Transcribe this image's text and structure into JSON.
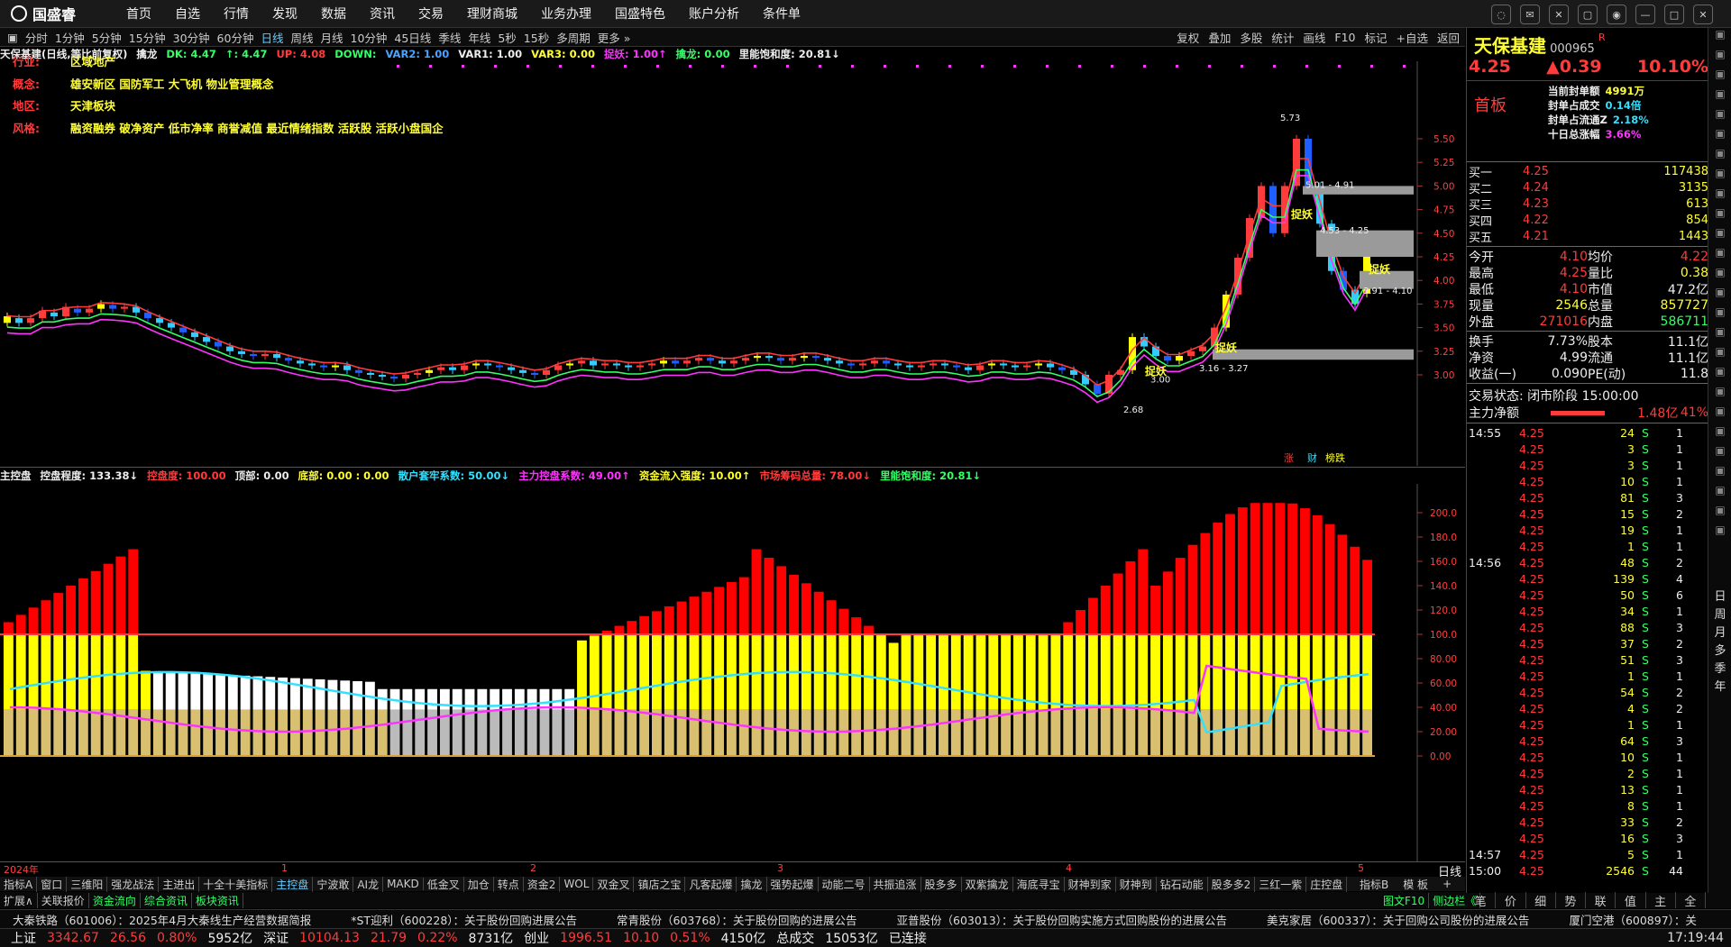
{
  "app": {
    "brand": "国盛睿"
  },
  "menu": [
    "首页",
    "自选",
    "行情",
    "发现",
    "数据",
    "资讯",
    "交易",
    "理财商城",
    "业务办理",
    "国盛特色",
    "账户分析",
    "条件单"
  ],
  "periods": [
    "分时",
    "1分钟",
    "5分钟",
    "15分钟",
    "30分钟",
    "60分钟",
    "日线",
    "周线",
    "月线",
    "10分钟",
    "45日线",
    "季线",
    "年线",
    "5秒",
    "15秒",
    "多周期",
    "更多"
  ],
  "period_active": "日线",
  "tools": [
    "复权",
    "叠加",
    "多股",
    "统计",
    "画线",
    "F10",
    "标记",
    "+自选",
    "返回"
  ],
  "main_title": "天保基建(日线,等比前复权)",
  "main_ind_name": "擒龙",
  "main_ind": [
    {
      "t": "DK: 4.47",
      "c": "#33ff66"
    },
    {
      "t": "↑: 4.47",
      "c": "#33ff66"
    },
    {
      "t": "UP: 4.08",
      "c": "#ff3b3b"
    },
    {
      "t": "DOWN: ",
      "c": "#33ff66"
    },
    {
      "t": "VAR2: 1.00",
      "c": "#4aa3ff"
    },
    {
      "t": "VAR1: 1.00",
      "c": "#eee"
    },
    {
      "t": "VAR3: 0.00",
      "c": "#ffff33"
    },
    {
      "t": "捉妖: 1.00↑",
      "c": "#ff33ff"
    },
    {
      "t": "擒龙: 0.00",
      "c": "#33ff66"
    },
    {
      "t": "里能饱和度: 20.81↓",
      "c": "#eee"
    }
  ],
  "info": [
    {
      "k": "行业:",
      "v": "区域地产"
    },
    {
      "k": "概念:",
      "v": "雄安新区 国防军工 大飞机 物业管理概念"
    },
    {
      "k": "地区:",
      "v": "天津板块"
    },
    {
      "k": "风格:",
      "v": "融资融券 破净资产 低市净率 商誉减值 最近情绪指数 活跃股 活跃小盘国企"
    }
  ],
  "price_axis": [
    "5.50",
    "5.25",
    "5.00",
    "4.75",
    "4.50",
    "4.25",
    "4.00",
    "3.75",
    "3.50",
    "3.25",
    "3.00"
  ],
  "annotations": {
    "high": "5.73",
    "low": "2.68",
    "r1": "5.01 - 4.91",
    "r2": "4.53 - 4.25",
    "r3": "3.91 - 4.10",
    "r4": "3.16 - 3.27",
    "r5": "3.00",
    "tag": "捉妖",
    "bottom_tags": [
      "涨",
      "财",
      "榜跌"
    ]
  },
  "sub_title": "主控盘",
  "sub_ind": [
    {
      "t": "控盘程度: 133.38↓",
      "c": "#eee"
    },
    {
      "t": "控盘度: 100.00",
      "c": "#ff3b3b"
    },
    {
      "t": "顶部: 0.00",
      "c": "#eee"
    },
    {
      "t": "底部: 0.00 : 0.00",
      "c": "#ffff33"
    },
    {
      "t": "散户套牢系数: 50.00↓",
      "c": "#33e0ff"
    },
    {
      "t": "主力控盘系数: 49.00↑",
      "c": "#ff33ff"
    },
    {
      "t": "资金流入强度: 10.00↑",
      "c": "#ffff33"
    },
    {
      "t": "市场筹码总量: 78.00↓",
      "c": "#ff3b3b"
    },
    {
      "t": "里能饱和度: 20.81↓",
      "c": "#33ff66"
    }
  ],
  "sub_axis": [
    "200.0",
    "180.0",
    "160.0",
    "140.0",
    "120.0",
    "100.0",
    "80.00",
    "60.00",
    "40.00",
    "20.00",
    "0.00"
  ],
  "date_axis": [
    "2024年",
    "1",
    "2",
    "3",
    "4",
    "5"
  ],
  "date_axis_right": "日线",
  "bottom_tabs": [
    "指标A",
    "窗口",
    "三维阳",
    "强龙战法",
    "主进出",
    "十全十美指标",
    "主控盘",
    "宁波敢",
    "AI龙",
    "MAKD",
    "低金叉",
    "加仓",
    "转点",
    "资金2",
    "WOL",
    "双金叉",
    "镇店之宝",
    "凡客起爆",
    "擒龙",
    "强势起爆",
    "动能二号",
    "共振追涨",
    "股多多",
    "双紫擒龙",
    "海底寻宝",
    "财神到家",
    "财神到",
    "钻石动能",
    "股多多2",
    "三红一紫",
    "庄控盘"
  ],
  "bottom_tab_active": "主控盘",
  "bottom_tabs_right": [
    "指标B",
    "模 板",
    "+",
    "-"
  ],
  "sub_tabs": [
    "扩展∧",
    "关联报价",
    "资金流向",
    "综合资讯",
    "板块资讯"
  ],
  "sub_tabs_right": [
    "图文F10",
    "侧边栏《"
  ],
  "news": [
    "大秦铁路（601006）：2025年4月大秦线生产经营数据简报",
    "*ST迎利（600228）：关于股份回购进展公告",
    "常青股份（603768）：关于股份回购的进展公告",
    "亚普股份（603013）：关于股份回购实施方式回购股份的进展公告",
    "美克家居（600337）：关于回购公司股份的进展公告",
    "厦门空港（600897）：关"
  ],
  "status": [
    {
      "t": "上证",
      "c": "#eee"
    },
    {
      "t": "3342.67",
      "c": "#ff3b3b"
    },
    {
      "t": "26.56",
      "c": "#ff3b3b"
    },
    {
      "t": "0.80%",
      "c": "#ff3b3b"
    },
    {
      "t": "5952亿",
      "c": "#eee"
    },
    {
      "t": "深证",
      "c": "#eee"
    },
    {
      "t": "10104.13",
      "c": "#ff3b3b"
    },
    {
      "t": "21.79",
      "c": "#ff3b3b"
    },
    {
      "t": "0.22%",
      "c": "#ff3b3b"
    },
    {
      "t": "8731亿",
      "c": "#eee"
    },
    {
      "t": "创业",
      "c": "#eee"
    },
    {
      "t": "1996.51",
      "c": "#ff3b3b"
    },
    {
      "t": "10.10",
      "c": "#ff3b3b"
    },
    {
      "t": "0.51%",
      "c": "#ff3b3b"
    },
    {
      "t": "4150亿",
      "c": "#eee"
    },
    {
      "t": "总成交",
      "c": "#eee"
    },
    {
      "t": "15053亿",
      "c": "#eee"
    },
    {
      "t": "已连接",
      "c": "#eee"
    }
  ],
  "clock": "17:19:44",
  "quote": {
    "name": "天保基建",
    "code": "000965",
    "mark": "R",
    "price": "4.25",
    "change": "▲0.39",
    "pct": "10.10%",
    "board": "首板",
    "stats": [
      {
        "k": "当前封单额",
        "v": "4991万"
      },
      {
        "k": "封单占成交",
        "v": "0.14倍"
      },
      {
        "k": "封单占流通Z",
        "v": "2.18%"
      },
      {
        "k": "十日总涨幅",
        "v": "3.66%"
      }
    ],
    "book": [
      {
        "k": "买一",
        "p": "4.25",
        "v": "117438"
      },
      {
        "k": "买二",
        "p": "4.24",
        "v": "3135"
      },
      {
        "k": "买三",
        "p": "4.23",
        "v": "613"
      },
      {
        "k": "买四",
        "p": "4.22",
        "v": "854"
      },
      {
        "k": "买五",
        "p": "4.21",
        "v": "1443"
      }
    ],
    "detail": [
      {
        "k1": "今开",
        "v1": "4.10",
        "k2": "均价",
        "v2": "4.22"
      },
      {
        "k1": "最高",
        "v1": "4.25",
        "k2": "量比",
        "v2": "0.38"
      },
      {
        "k1": "最低",
        "v1": "4.10",
        "k2": "市值",
        "v2": "47.2亿"
      },
      {
        "k1": "现量",
        "v1": "2546",
        "k2": "总量",
        "v2": "857727"
      },
      {
        "k1": "外盘",
        "v1": "271016",
        "k2": "内盘",
        "v2": "586711"
      }
    ],
    "detail2": [
      {
        "k1": "换手",
        "v1": "7.73%",
        "k2": "股本",
        "v2": "11.1亿"
      },
      {
        "k1": "净资",
        "v1": "4.99",
        "k2": "流通",
        "v2": "11.1亿"
      },
      {
        "k1": "收益(一)",
        "v1": "0.090",
        "k2": "PE(动)",
        "v2": "11.8"
      }
    ],
    "trade_status": "交易状态: 闭市阶段 15:00:00",
    "main_net": {
      "k": "主力净额",
      "v": "1.48亿",
      "p": "41%"
    },
    "trades": [
      {
        "t": "14:55",
        "p": "4.25",
        "v": "24",
        "s": "S",
        "n": "1"
      },
      {
        "t": "",
        "p": "4.25",
        "v": "3",
        "s": "S",
        "n": "1"
      },
      {
        "t": "",
        "p": "4.25",
        "v": "3",
        "s": "S",
        "n": "1"
      },
      {
        "t": "",
        "p": "4.25",
        "v": "10",
        "s": "S",
        "n": "1"
      },
      {
        "t": "",
        "p": "4.25",
        "v": "81",
        "s": "S",
        "n": "3"
      },
      {
        "t": "",
        "p": "4.25",
        "v": "15",
        "s": "S",
        "n": "2"
      },
      {
        "t": "",
        "p": "4.25",
        "v": "19",
        "s": "S",
        "n": "1"
      },
      {
        "t": "",
        "p": "4.25",
        "v": "1",
        "s": "S",
        "n": "1"
      },
      {
        "t": "14:56",
        "p": "4.25",
        "v": "48",
        "s": "S",
        "n": "2"
      },
      {
        "t": "",
        "p": "4.25",
        "v": "139",
        "s": "S",
        "n": "4"
      },
      {
        "t": "",
        "p": "4.25",
        "v": "50",
        "s": "S",
        "n": "6"
      },
      {
        "t": "",
        "p": "4.25",
        "v": "34",
        "s": "S",
        "n": "1"
      },
      {
        "t": "",
        "p": "4.25",
        "v": "88",
        "s": "S",
        "n": "3"
      },
      {
        "t": "",
        "p": "4.25",
        "v": "37",
        "s": "S",
        "n": "2"
      },
      {
        "t": "",
        "p": "4.25",
        "v": "51",
        "s": "S",
        "n": "3"
      },
      {
        "t": "",
        "p": "4.25",
        "v": "1",
        "s": "S",
        "n": "1"
      },
      {
        "t": "",
        "p": "4.25",
        "v": "54",
        "s": "S",
        "n": "2"
      },
      {
        "t": "",
        "p": "4.25",
        "v": "4",
        "s": "S",
        "n": "2"
      },
      {
        "t": "",
        "p": "4.25",
        "v": "1",
        "s": "S",
        "n": "1"
      },
      {
        "t": "",
        "p": "4.25",
        "v": "64",
        "s": "S",
        "n": "3"
      },
      {
        "t": "",
        "p": "4.25",
        "v": "10",
        "s": "S",
        "n": "1"
      },
      {
        "t": "",
        "p": "4.25",
        "v": "2",
        "s": "S",
        "n": "1"
      },
      {
        "t": "",
        "p": "4.25",
        "v": "13",
        "s": "S",
        "n": "1"
      },
      {
        "t": "",
        "p": "4.25",
        "v": "8",
        "s": "S",
        "n": "1"
      },
      {
        "t": "",
        "p": "4.25",
        "v": "33",
        "s": "S",
        "n": "2"
      },
      {
        "t": "",
        "p": "4.25",
        "v": "16",
        "s": "S",
        "n": "3"
      },
      {
        "t": "14:57",
        "p": "4.25",
        "v": "5",
        "s": "S",
        "n": "1"
      },
      {
        "t": "15:00",
        "p": "4.25",
        "v": "2546",
        "s": "S",
        "n": "44"
      }
    ],
    "bottom_tabs": [
      "笔",
      "价",
      "细",
      "势",
      "联",
      "值",
      "主",
      "全"
    ]
  },
  "vtabs": [
    "日",
    "周",
    "月",
    "多",
    "季",
    "年"
  ]
}
